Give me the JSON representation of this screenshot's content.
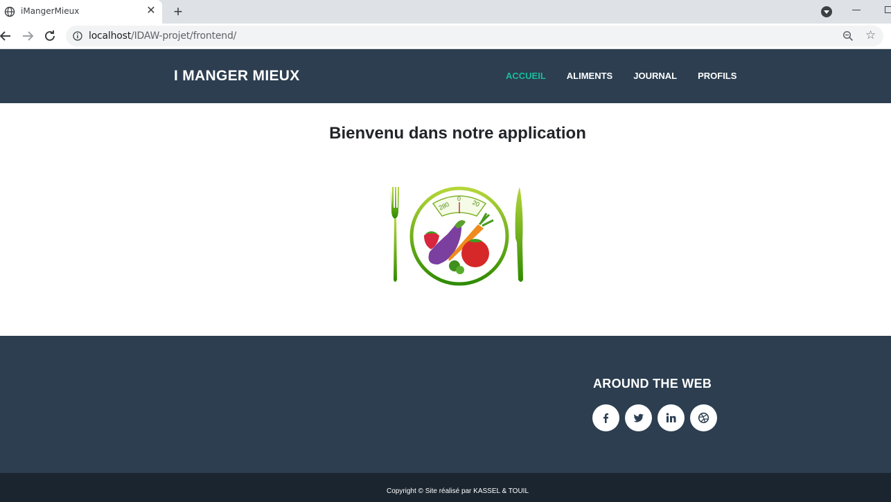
{
  "browser": {
    "tab_title": "iMangerMieux",
    "new_tab_symbol": "+",
    "close_symbol": "✕",
    "url_host": "localhost",
    "url_path": "/IDAW-projet/frontend/"
  },
  "nav": {
    "brand": "I MANGER MIEUX",
    "items": [
      {
        "label": "ACCUEIL",
        "active": true
      },
      {
        "label": "ALIMENTS",
        "active": false
      },
      {
        "label": "JOURNAL",
        "active": false
      },
      {
        "label": "PROFILS",
        "active": false
      }
    ]
  },
  "main": {
    "headline": "Bienvenu dans notre application",
    "logo_scale_labels": [
      "280",
      "0",
      "20"
    ]
  },
  "footer": {
    "around_title": "AROUND THE WEB",
    "socials": [
      "facebook-icon",
      "twitter-icon",
      "linkedin-icon",
      "dribbble-icon"
    ],
    "copyright": "Copyright © Site réalisé par KASSEL & TOUIL"
  },
  "colors": {
    "nav_bg": "#2c3e50",
    "accent": "#1abc9c",
    "copyright_bg": "#1a252f"
  }
}
